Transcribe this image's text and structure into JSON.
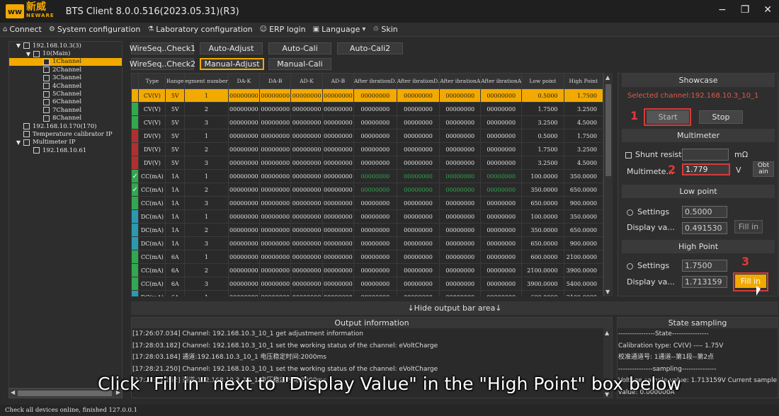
{
  "app": {
    "logo_cn": "新威",
    "logo_en": "NEWARE",
    "title": "BTS Client 8.0.0.516(2023.05.31)(R3)"
  },
  "window_controls": {
    "minimize": "−",
    "restore": "❐",
    "close": "✕"
  },
  "menu": [
    {
      "icon": "connect-icon",
      "label": "Connect"
    },
    {
      "icon": "gear-icon",
      "label": "System configuration"
    },
    {
      "icon": "flask-icon",
      "label": "Laboratory configuration"
    },
    {
      "icon": "user-icon",
      "label": "ERP login"
    },
    {
      "icon": "language-icon",
      "label": "Language"
    },
    {
      "icon": "skin-icon",
      "label": "Skin"
    }
  ],
  "tree": [
    {
      "label": "192.168.10.3(3)",
      "indent": 0,
      "chev": true
    },
    {
      "label": "10(Main)",
      "indent": 1,
      "chev": true
    },
    {
      "label": "1Channel",
      "indent": 2,
      "selected": true
    },
    {
      "label": "2Channel",
      "indent": 2
    },
    {
      "label": "3Channel",
      "indent": 2
    },
    {
      "label": "4Channel",
      "indent": 2
    },
    {
      "label": "5Channel",
      "indent": 2
    },
    {
      "label": "6Channel",
      "indent": 2
    },
    {
      "label": "7Channel",
      "indent": 2
    },
    {
      "label": "8Channel",
      "indent": 2
    },
    {
      "label": "192.168.10.170(170)",
      "indent": 0
    },
    {
      "label": "Temperature calibrator IP",
      "indent": 0
    },
    {
      "label": "Multimeter IP",
      "indent": 0,
      "chev": true
    },
    {
      "label": "192.168.10.61",
      "indent": 1
    }
  ],
  "buttons_row1": [
    "WireSeq..Check1",
    "Auto-Adjust",
    "Auto-Cali",
    "Auto-Cali2"
  ],
  "buttons_row2": [
    "WireSeq..Check2",
    "Manual-Adjust",
    "Manual-Cali"
  ],
  "table": {
    "headers": [
      "",
      "Type",
      "Range",
      "egment number",
      "DA-K",
      "DA-B",
      "AD-K",
      "AD-B",
      "After ibrationD.",
      "After ibrationD.",
      "After ibrationA",
      "After ibrationA",
      "Low point",
      "High Point"
    ],
    "rows": [
      {
        "marker": "#f2a900",
        "check": false,
        "type": "CV(V)",
        "range": "5V",
        "seg": "1",
        "dak": "00000000",
        "dab": "00000000",
        "adk": "00000000",
        "adb": "00000000",
        "c1": "00000000",
        "c2": "00000000",
        "c3": "00000000",
        "c4": "00000000",
        "low": "0.5000",
        "high": "1.7500",
        "selected": true
      },
      {
        "marker": "#2fa84f",
        "check": false,
        "type": "CV(V)",
        "range": "5V",
        "seg": "2",
        "dak": "00000000",
        "dab": "00000000",
        "adk": "00000000",
        "adb": "00000000",
        "c1": "00000000",
        "c2": "00000000",
        "c3": "00000000",
        "c4": "00000000",
        "low": "1.7500",
        "high": "3.2500"
      },
      {
        "marker": "#2fa84f",
        "check": false,
        "type": "CV(V)",
        "range": "5V",
        "seg": "3",
        "dak": "00000000",
        "dab": "00000000",
        "adk": "00000000",
        "adb": "00000000",
        "c1": "00000000",
        "c2": "00000000",
        "c3": "00000000",
        "c4": "00000000",
        "low": "3.2500",
        "high": "4.5000"
      },
      {
        "marker": "#b03030",
        "check": false,
        "type": "DV(V)",
        "range": "5V",
        "seg": "1",
        "dak": "00000000",
        "dab": "00000000",
        "adk": "00000000",
        "adb": "00000000",
        "c1": "00000000",
        "c2": "00000000",
        "c3": "00000000",
        "c4": "00000000",
        "low": "0.5000",
        "high": "1.7500"
      },
      {
        "marker": "#b03030",
        "check": false,
        "type": "DV(V)",
        "range": "5V",
        "seg": "2",
        "dak": "00000000",
        "dab": "00000000",
        "adk": "00000000",
        "adb": "00000000",
        "c1": "00000000",
        "c2": "00000000",
        "c3": "00000000",
        "c4": "00000000",
        "low": "1.7500",
        "high": "3.2500"
      },
      {
        "marker": "#b03030",
        "check": false,
        "type": "DV(V)",
        "range": "5V",
        "seg": "3",
        "dak": "00000000",
        "dab": "00000000",
        "adk": "00000000",
        "adb": "00000000",
        "c1": "00000000",
        "c2": "00000000",
        "c3": "00000000",
        "c4": "00000000",
        "low": "3.2500",
        "high": "4.5000"
      },
      {
        "marker": "#2fa84f",
        "check": true,
        "type": "CC(mA)",
        "range": "1A",
        "seg": "1",
        "dak": "00000000",
        "dab": "00000000",
        "adk": "00000000",
        "adb": "00000000",
        "c1": "00000000",
        "c2": "00000000",
        "c3": "00000000",
        "c4": "00000000",
        "low": "100.0000",
        "high": "350.0000",
        "green": true
      },
      {
        "marker": "#2fa84f",
        "check": true,
        "type": "CC(mA)",
        "range": "1A",
        "seg": "2",
        "dak": "00000000",
        "dab": "00000000",
        "adk": "00000000",
        "adb": "00000000",
        "c1": "00000000",
        "c2": "00000000",
        "c3": "00000000",
        "c4": "00000000",
        "low": "350.0000",
        "high": "650.0000",
        "green": true
      },
      {
        "marker": "#2fa84f",
        "check": false,
        "type": "CC(mA)",
        "range": "1A",
        "seg": "3",
        "dak": "00000000",
        "dab": "00000000",
        "adk": "00000000",
        "adb": "00000000",
        "c1": "00000000",
        "c2": "00000000",
        "c3": "00000000",
        "c4": "00000000",
        "low": "650.0000",
        "high": "900.0000"
      },
      {
        "marker": "#2a9ab0",
        "check": false,
        "type": "DC(mA)",
        "range": "1A",
        "seg": "1",
        "dak": "00000000",
        "dab": "00000000",
        "adk": "00000000",
        "adb": "00000000",
        "c1": "00000000",
        "c2": "00000000",
        "c3": "00000000",
        "c4": "00000000",
        "low": "100.0000",
        "high": "350.0000"
      },
      {
        "marker": "#2a9ab0",
        "check": false,
        "type": "DC(mA)",
        "range": "1A",
        "seg": "2",
        "dak": "00000000",
        "dab": "00000000",
        "adk": "00000000",
        "adb": "00000000",
        "c1": "00000000",
        "c2": "00000000",
        "c3": "00000000",
        "c4": "00000000",
        "low": "350.0000",
        "high": "650.0000"
      },
      {
        "marker": "#2a9ab0",
        "check": false,
        "type": "DC(mA)",
        "range": "1A",
        "seg": "3",
        "dak": "00000000",
        "dab": "00000000",
        "adk": "00000000",
        "adb": "00000000",
        "c1": "00000000",
        "c2": "00000000",
        "c3": "00000000",
        "c4": "00000000",
        "low": "650.0000",
        "high": "900.0000"
      },
      {
        "marker": "#2fa84f",
        "check": false,
        "type": "CC(mA)",
        "range": "6A",
        "seg": "1",
        "dak": "00000000",
        "dab": "00000000",
        "adk": "00000000",
        "adb": "00000000",
        "c1": "00000000",
        "c2": "00000000",
        "c3": "00000000",
        "c4": "00000000",
        "low": "600.0000",
        "high": "2100.0000"
      },
      {
        "marker": "#2fa84f",
        "check": false,
        "type": "CC(mA)",
        "range": "6A",
        "seg": "2",
        "dak": "00000000",
        "dab": "00000000",
        "adk": "00000000",
        "adb": "00000000",
        "c1": "00000000",
        "c2": "00000000",
        "c3": "00000000",
        "c4": "00000000",
        "low": "2100.0000",
        "high": "3900.0000"
      },
      {
        "marker": "#2fa84f",
        "check": false,
        "type": "CC(mA)",
        "range": "6A",
        "seg": "3",
        "dak": "00000000",
        "dab": "00000000",
        "adk": "00000000",
        "adb": "00000000",
        "c1": "00000000",
        "c2": "00000000",
        "c3": "00000000",
        "c4": "00000000",
        "low": "3900.0000",
        "high": "5400.0000"
      },
      {
        "marker": "#2a9ab0",
        "check": false,
        "type": "DC(mA)",
        "range": "6A",
        "seg": "1",
        "dak": "00000000",
        "dab": "00000000",
        "adk": "00000000",
        "adb": "00000000",
        "c1": "00000000",
        "c2": "00000000",
        "c3": "00000000",
        "c4": "00000000",
        "low": "600.0000",
        "high": "2100.0000"
      }
    ]
  },
  "showcase": {
    "title": "Showcase",
    "selected_channel": "Selected channel:192.168.10.3_10_1",
    "start": "Start",
    "stop": "Stop",
    "step1": "1"
  },
  "multimeter": {
    "title": "Multimeter",
    "shunt_label": "Shunt resista",
    "shunt_unit": "mΩ",
    "meter_label": "Multimete...",
    "meter_value": "1.779",
    "meter_unit": "V",
    "obtain": "Obt ain",
    "step2": "2"
  },
  "low_point": {
    "title": "Low point",
    "settings_label": "Settings",
    "settings_value": "0.5000",
    "display_label": "Display va...",
    "display_value": "0.491530",
    "fill": "Fill in"
  },
  "high_point": {
    "title": "High Point",
    "settings_label": "Settings",
    "settings_value": "1.7500",
    "display_label": "Display va...",
    "display_value": "1.713159",
    "fill": "Fill in",
    "step3": "3"
  },
  "hide_bar": "↓Hide output bar area↓",
  "output": {
    "title": "Output information",
    "lines": [
      "[17:26:07.034] Channel: 192.168.10.3_10_1 get adjustment information",
      "[17:28:03.182] Channel: 192.168.10.3_10_1 set the working status of the channel: eVoltCharge",
      "[17:28:03.184] 通道:192.168.10.3_10_1 电压稳定时间:2000ms",
      "[17:28:21.250] Channel: 192.168.10.3_10_1 set the working status of the channel: eVoltCharge",
      "[17:28:21.252] 通道:192.168.10.3_10_1 电压稳定时间:2000ms"
    ]
  },
  "state_sampling": {
    "title": "State sampling",
    "lines": [
      "----------------State----------------",
      "Calibration type:  CV(V) ---- 1.75V",
      "校准通道号: 1通道--第1段--第2点",
      "---------------sampling---------------",
      "Voltage sample value: 1.713159V  Current sample",
      "value: 0.000000A"
    ]
  },
  "status": "Check all devices online, finished 127.0.0.1",
  "subtitle": "Click \"Fill in\" next to \"Display Value\" in the \"High Point\" box below"
}
